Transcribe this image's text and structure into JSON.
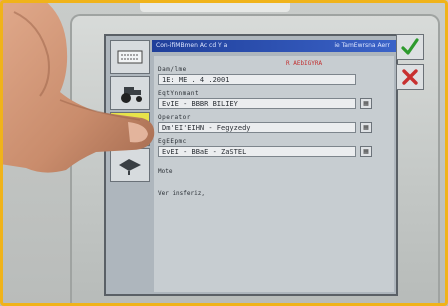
{
  "window": {
    "title": "Con-ifiMBmen Ac cd Y a",
    "title_right": "ie TamEwrsna Aerr"
  },
  "form": {
    "red_note": "R AEbIGYRA",
    "fields": [
      {
        "label": "Dam/lme",
        "value": "1E: ME . 4 .2001"
      },
      {
        "label": "EqtYnnmant",
        "value": "EvIE - BBBR BILIEY"
      },
      {
        "label": "Operator",
        "value": "Dm'EI'EIHN - Fegyzedy"
      },
      {
        "label": "EgEEpmc",
        "value": "EvEI - BBaE - ZaSTEL"
      }
    ],
    "notes_label": "Mote",
    "notes_text": "Ver insferiz,"
  },
  "sidebar": {
    "items": [
      {
        "icon": "keyboard-icon",
        "active": false
      },
      {
        "icon": "tractor-icon",
        "active": false
      },
      {
        "icon": "operator-icon",
        "active": true
      },
      {
        "icon": "implement-icon",
        "active": false
      }
    ]
  },
  "actions": {
    "ok_icon": "checkmark-icon",
    "cancel_icon": "close-icon"
  },
  "colors": {
    "titlebar": "#2d53b8",
    "active_item": "#e7e34a",
    "ok": "#2e9a2e",
    "cancel": "#c83030",
    "note": "#c23030"
  }
}
